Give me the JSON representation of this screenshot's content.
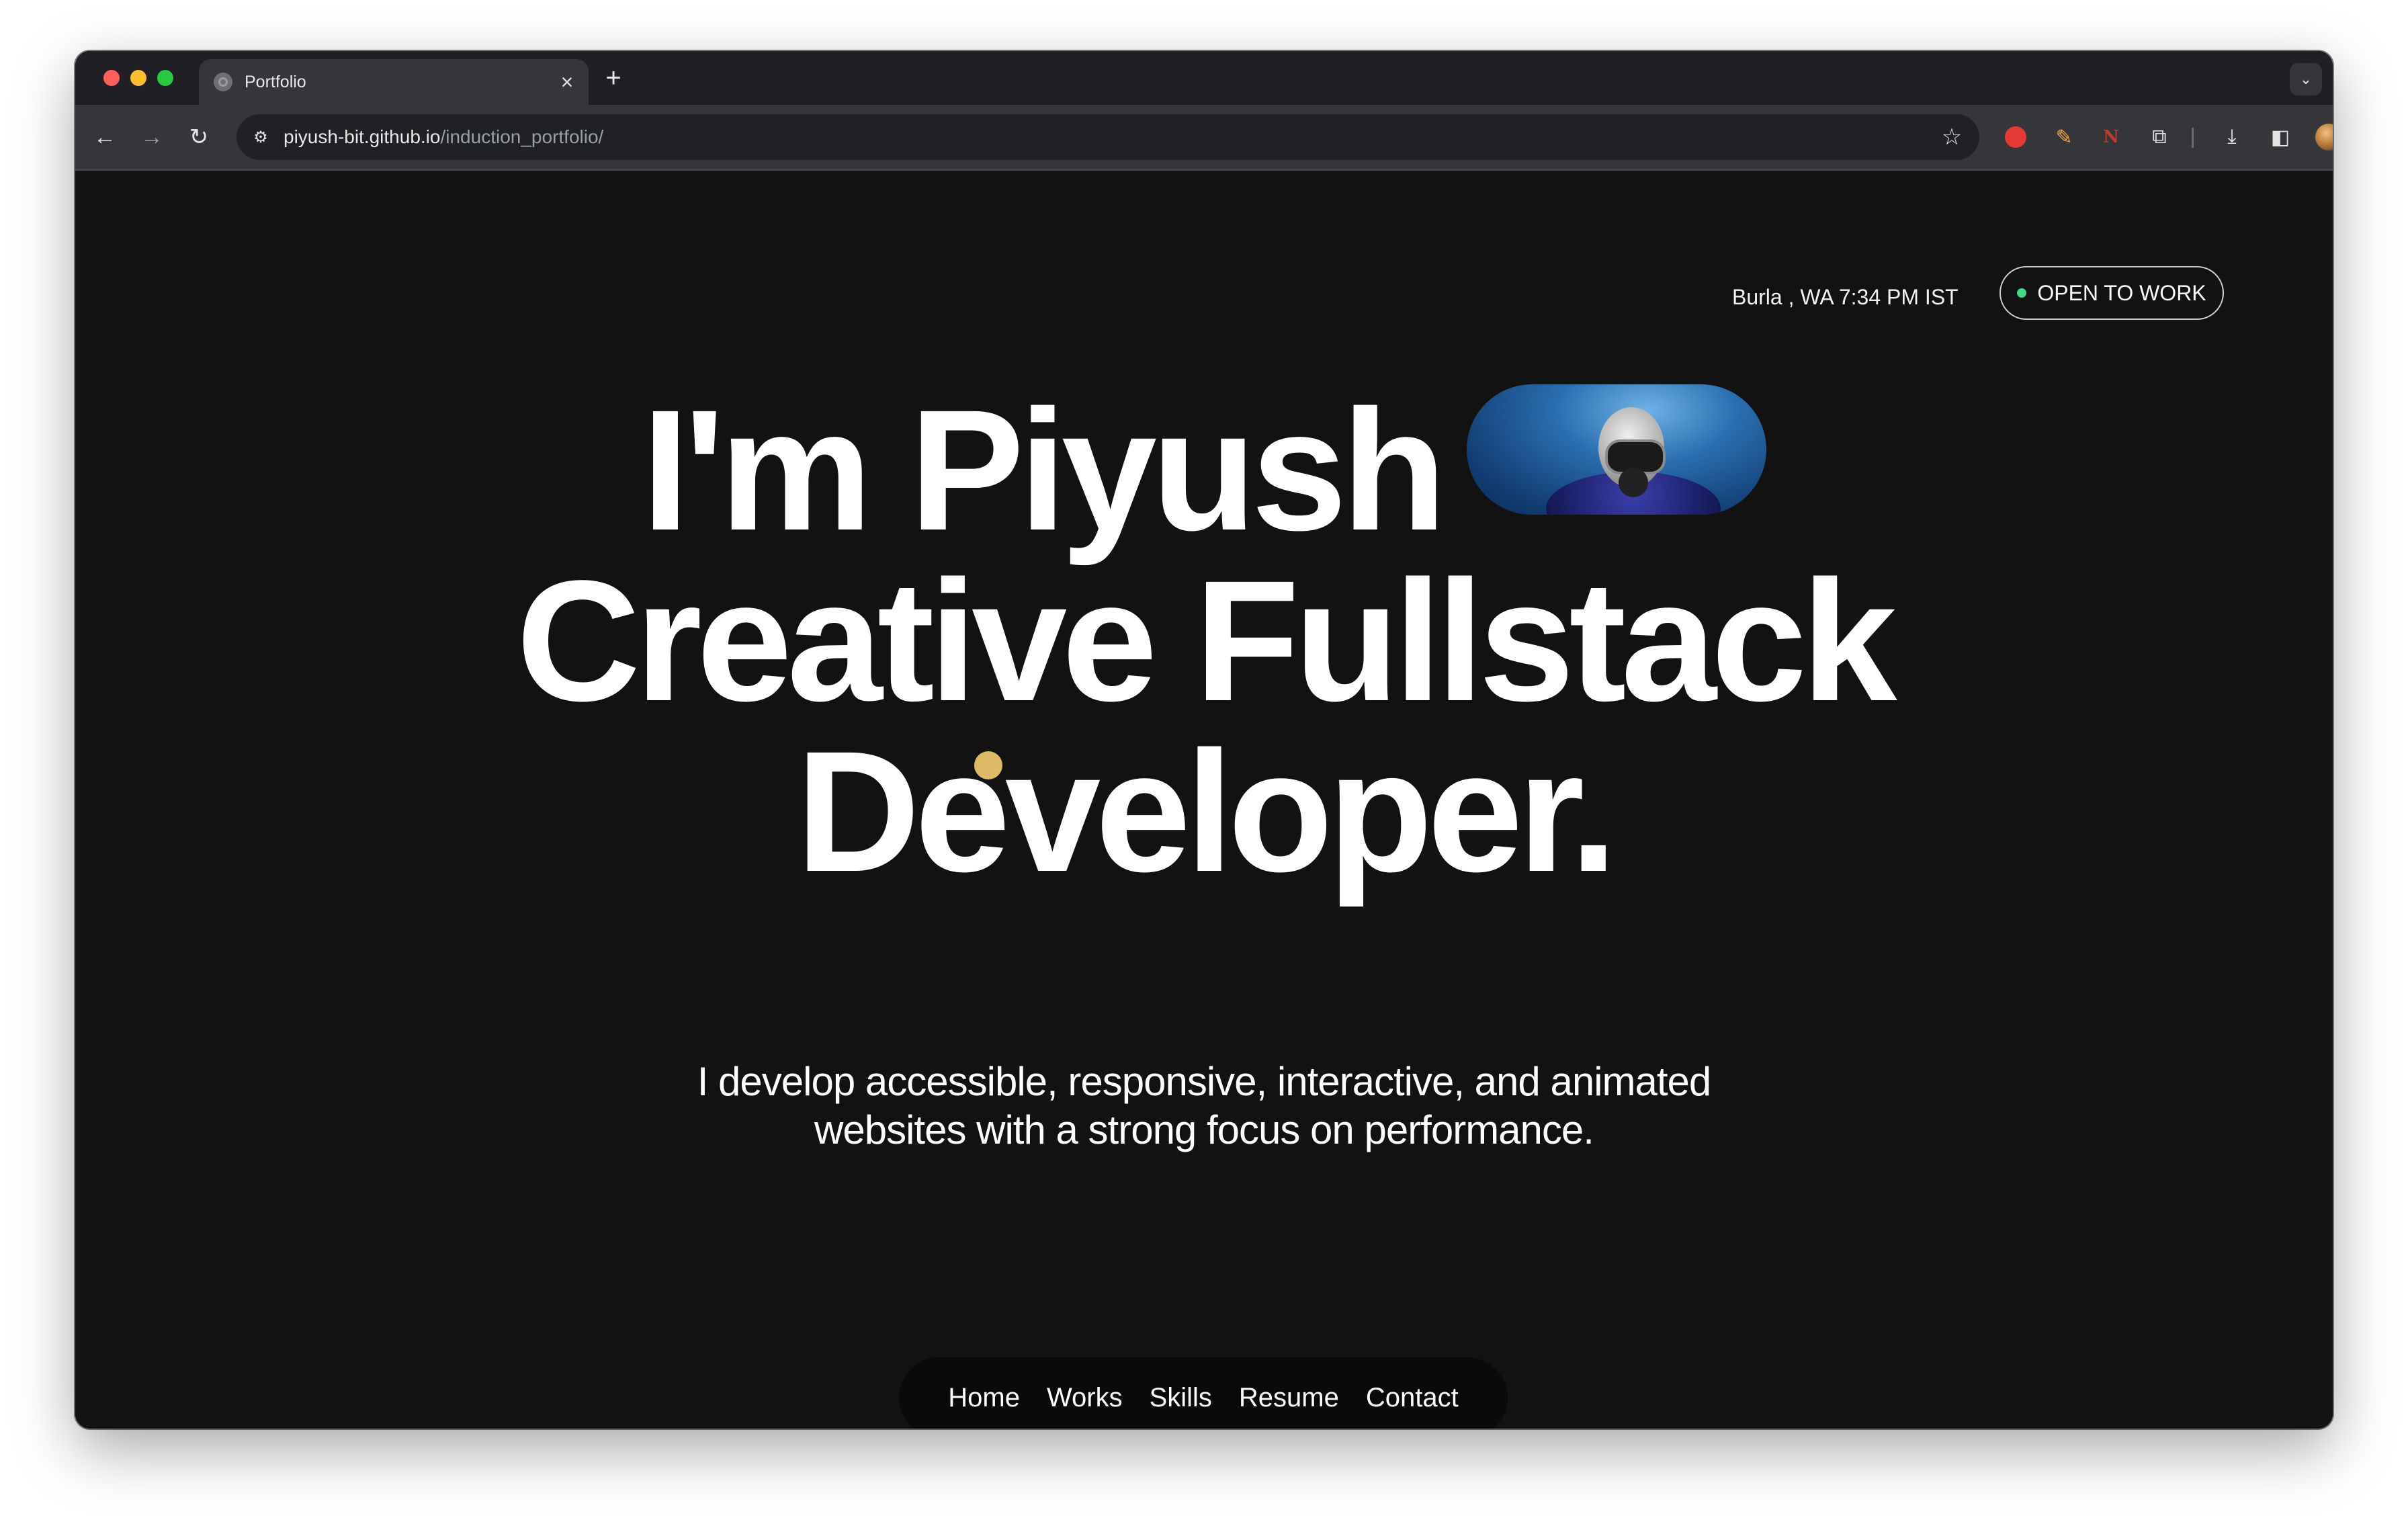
{
  "browser": {
    "tab_title": "Portfolio",
    "tab_close": "×",
    "new_tab": "+",
    "tab_search": "⌄",
    "url_host": "piyush-bit.github.io",
    "url_path": "/induction_portfolio/",
    "icons": [
      "back-arrow-icon",
      "forward-arrow-icon",
      "reload-icon",
      "site-info-icon",
      "bookmark-star-icon",
      "record-extension-icon",
      "pen-extension-icon",
      "ni-extension-icon",
      "puzzle-extensions-icon",
      "download-icon",
      "side-panel-icon",
      "profile-avatar-icon",
      "kebab-menu-icon"
    ]
  },
  "header": {
    "location": "Burla , WA 7:34 PM IST",
    "status_label": "OPEN TO WORK",
    "status_color": "#3ddc84"
  },
  "hero": {
    "line1": "I'm Piyush",
    "line2": "Creative Fullstack",
    "line3": "Developer.",
    "tagline_line1": "I develop accessible, responsive, interactive, and animated",
    "tagline_line2": "websites with a strong focus on performance."
  },
  "nav": {
    "items": [
      "Home",
      "Works",
      "Skills",
      "Resume",
      "Contact"
    ]
  },
  "colors": {
    "background": "#121212",
    "cursor_dot": "#e9c46a"
  }
}
